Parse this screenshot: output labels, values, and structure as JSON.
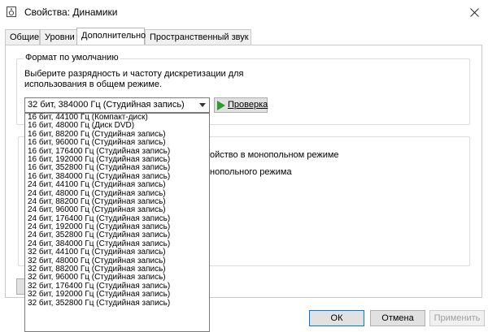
{
  "window": {
    "title": "Свойства: Динамики"
  },
  "tabs": [
    {
      "label": "Общие"
    },
    {
      "label": "Уровни"
    },
    {
      "label": "Дополнительно"
    },
    {
      "label": "Пространственный звук"
    }
  ],
  "default_format": {
    "group_title": "Формат по умолчанию",
    "description": "Выберите разрядность и частоту дискретизации для использования в общем режиме.",
    "selected_value": "32 бит, 384000 Гц (Студийная запись)",
    "test_button": "Проверка",
    "options": [
      "16 бит, 44100 Гц (Компакт-диск)",
      "16 бит, 48000 Гц (Диск DVD)",
      "16 бит, 88200 Гц (Студийная запись)",
      "16 бит, 96000 Гц (Студийная запись)",
      "16 бит, 176400 Гц (Студийная запись)",
      "16 бит, 192000 Гц (Студийная запись)",
      "16 бит, 352800 Гц (Студийная запись)",
      "16 бит, 384000 Гц (Студийная запись)",
      "24 бит, 44100 Гц (Студийная запись)",
      "24 бит, 48000 Гц (Студийная запись)",
      "24 бит, 88200 Гц (Студийная запись)",
      "24 бит, 96000 Гц (Студийная запись)",
      "24 бит, 176400 Гц (Студийная запись)",
      "24 бит, 192000 Гц (Студийная запись)",
      "24 бит, 352800 Гц (Студийная запись)",
      "24 бит, 384000 Гц (Студийная запись)",
      "32 бит, 44100 Гц (Студийная запись)",
      "32 бит, 48000 Гц (Студийная запись)",
      "32 бит, 88200 Гц (Студийная запись)",
      "32 бит, 96000 Гц (Студийная запись)",
      "32 бит, 176400 Гц (Студийная запись)",
      "32 бит, 192000 Гц (Студийная запись)",
      "32 бит, 352800 Гц (Студийная запись)"
    ]
  },
  "exclusive_mode": {
    "option1_fragment": "ойство в монопольном режиме",
    "option2_fragment": "нопольного режима"
  },
  "footer": {
    "ok": "ОК",
    "cancel": "Отмена",
    "apply": "Применить"
  }
}
